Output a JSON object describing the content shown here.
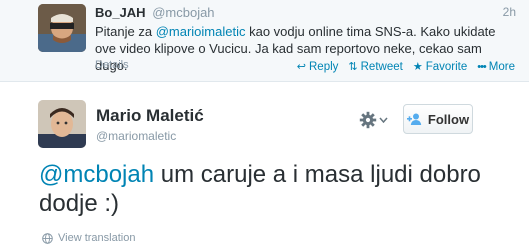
{
  "reply": {
    "name": "Bo_JAH",
    "handle": "@mcbojah",
    "time": "2h",
    "mention": "@marioimaletic",
    "text_before": "Pitanje za ",
    "text_after": " kao vodju online tima SNS-a. Kako ukidate ove video klipove o Vucicu. Ja kad sam reportovo neke, cekao sam dugo.",
    "details_label": "Details",
    "actions": {
      "reply": "Reply",
      "retweet": "Retweet",
      "favorite": "Favorite",
      "more": "More"
    },
    "icons": {
      "reply": "reply-arrow-icon",
      "retweet": "retweet-icon",
      "favorite": "star-icon",
      "more": "ellipsis-icon"
    }
  },
  "tweet": {
    "name": "Mario Maletić",
    "handle": "@mariomaletic",
    "mention": "@mcbojah",
    "text": " um caruje a i masa ljudi dobro dodje :)",
    "follow_label": "Follow",
    "translate_label": "View translation"
  },
  "colors": {
    "link": "#0084b4",
    "muted": "#8899a6",
    "reply_background": "#f5f8fa"
  }
}
